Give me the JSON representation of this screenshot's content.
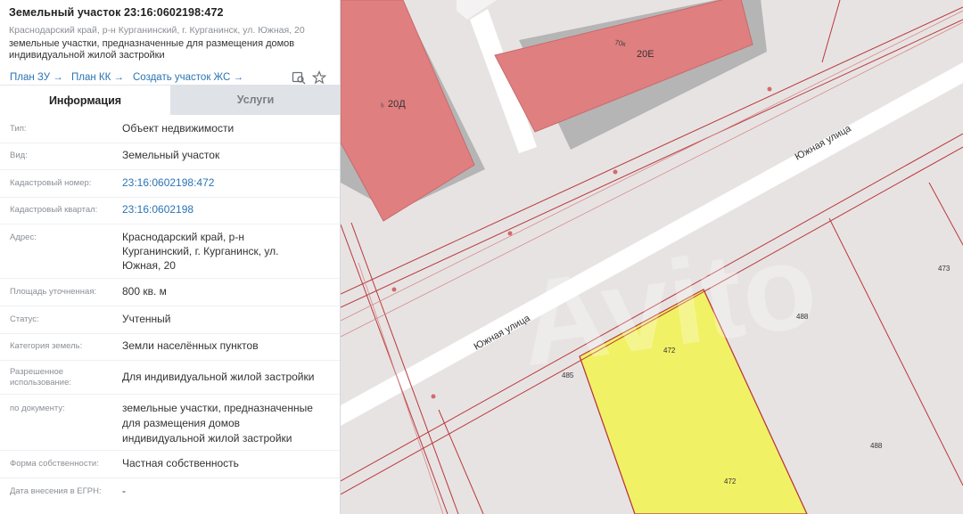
{
  "header": {
    "title": "Земельный участок 23:16:0602198:472",
    "address": "Краснодарский край, р-н Курганинский, г. Курганинск, ул. Южная, 20",
    "description_line1": "земельные участки, предназначенные для размещения домов",
    "description_line2": "индивидуальной жилой застройки"
  },
  "links": {
    "plan_zu": "План ЗУ →",
    "plan_kk": "План КК →",
    "create": "Создать участок ЖС →"
  },
  "tabs": {
    "info": "Информация",
    "services": "Услуги"
  },
  "fields": {
    "type": {
      "label": "Тип:",
      "value": "Объект недвижимости"
    },
    "kind": {
      "label": "Вид:",
      "value": "Земельный участок"
    },
    "cadastral_number": {
      "label": "Кадастровый номер:",
      "value": "23:16:0602198:472"
    },
    "cadastral_quarter": {
      "label": "Кадастровый квартал:",
      "value": "23:16:0602198"
    },
    "address": {
      "label": "Адрес:",
      "value_line1": "Краснодарский край, р-н",
      "value_line2": "Курганинский, г. Курганинск, ул.",
      "value_line3": "Южная, 20"
    },
    "area": {
      "label": "Площадь уточненная:",
      "value": "800 кв. м"
    },
    "status": {
      "label": "Статус:",
      "value": "Учтенный"
    },
    "land_category": {
      "label": "Категория земель:",
      "value": "Земли населённых пунктов"
    },
    "permitted_use": {
      "label_line1": "Разрешенное",
      "label_line2": "использование:",
      "value": "Для индивидуальной жилой застройки"
    },
    "by_document": {
      "label": "по документу:",
      "value_line1": "земельные участки, предназначенные",
      "value_line2": "для размещения домов",
      "value_line3": "индивидуальной жилой застройки"
    },
    "ownership": {
      "label": "Форма собственности:",
      "value": "Частная собственность"
    },
    "egrn_date": {
      "label": "Дата внесения в ЕГРН:",
      "value": "-"
    }
  },
  "map": {
    "building_left_label": "20Д",
    "building_left_prefix": "ê",
    "building_right_label": "20E",
    "building_right_prefix": "70к",
    "street_label_1": "Южная улица",
    "street_label_2": "Южная улица",
    "parcel_labels": {
      "p472_top": "472",
      "p472_bottom": "472",
      "p485": "485",
      "p488_top": "488",
      "p488_bottom": "488",
      "p473": "473"
    },
    "watermark": "Avito",
    "colors": {
      "land": "#e8e3e3",
      "building": "#e07f80",
      "building_shadow": "#b5b5b5",
      "road": "#ffffff",
      "selected_parcel": "#f1f166",
      "boundary": "#b8393b",
      "link": "#2a74b5"
    }
  }
}
